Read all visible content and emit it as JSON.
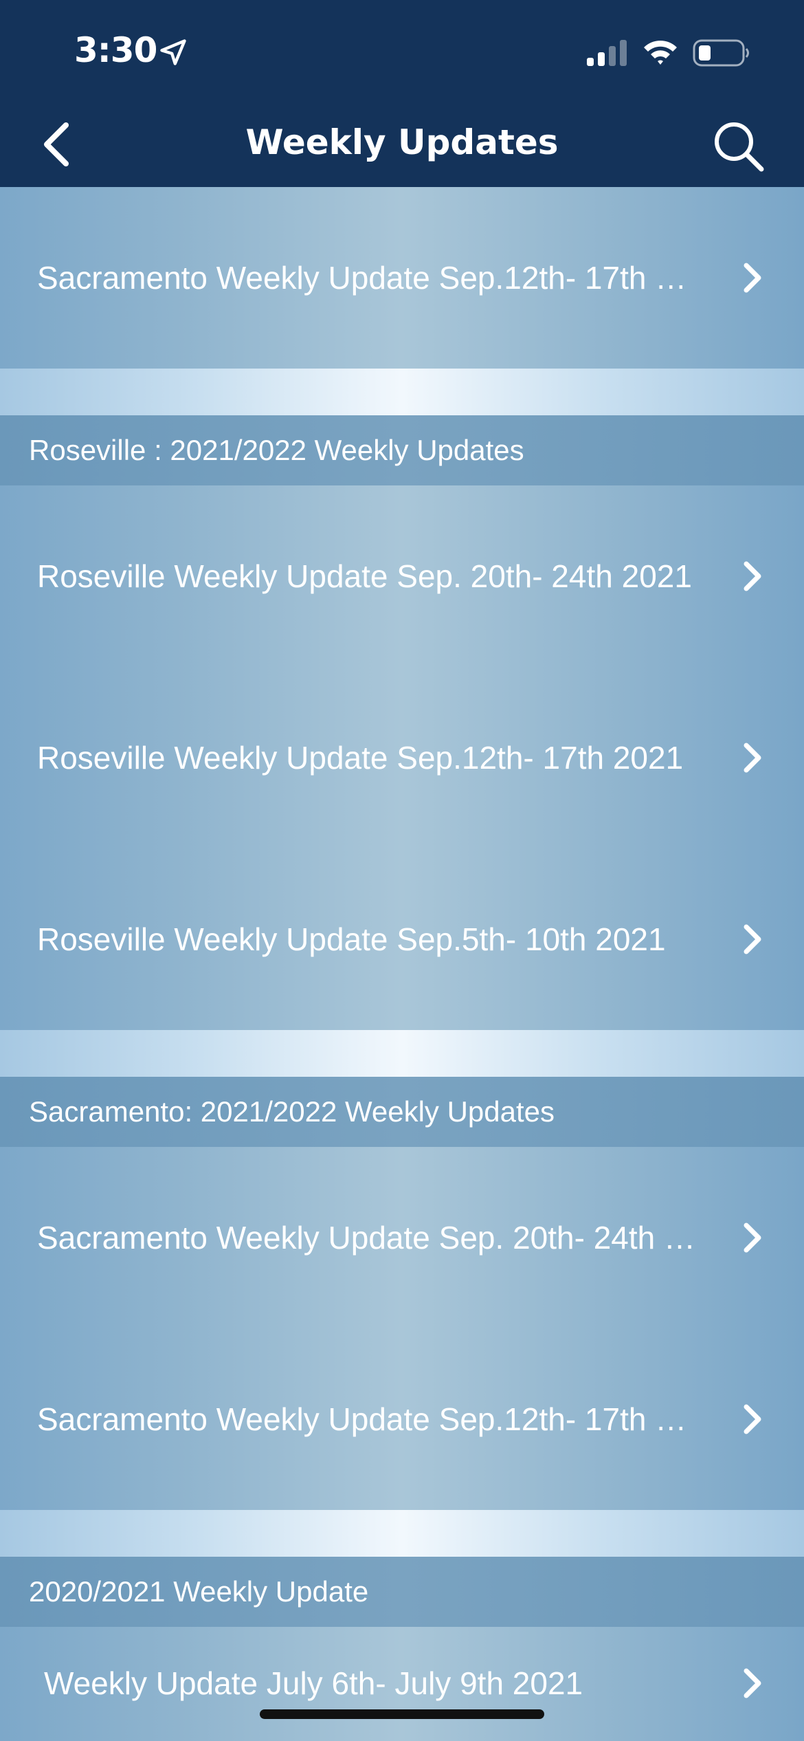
{
  "status": {
    "time": "3:30"
  },
  "nav": {
    "title": "Weekly Updates"
  },
  "rows_top": [
    {
      "label": "Sacramento   Weekly Update Sep.12th- 17th 20..."
    }
  ],
  "sections": [
    {
      "title": "Roseville : 2021/2022 Weekly Updates",
      "rows": [
        {
          "label": "Roseville  Weekly Update Sep. 20th- 24th 2021"
        },
        {
          "label": "Roseville  Weekly Update Sep.12th- 17th 2021"
        },
        {
          "label": "Roseville Weekly Update Sep.5th- 10th 2021"
        }
      ]
    },
    {
      "title": "Sacramento: 2021/2022 Weekly Updates",
      "rows": [
        {
          "label": "Sacramento   Weekly Update Sep. 20th- 24th 2..."
        },
        {
          "label": "Sacramento   Weekly Update Sep.12th- 17th 20..."
        }
      ]
    },
    {
      "title": "2020/2021 Weekly Update",
      "rows": [
        {
          "label": "Weekly Update July 6th- July 9th 2021"
        }
      ]
    }
  ],
  "colors": {
    "nav_bg": "#14335a",
    "row_text": "#ffffff"
  }
}
